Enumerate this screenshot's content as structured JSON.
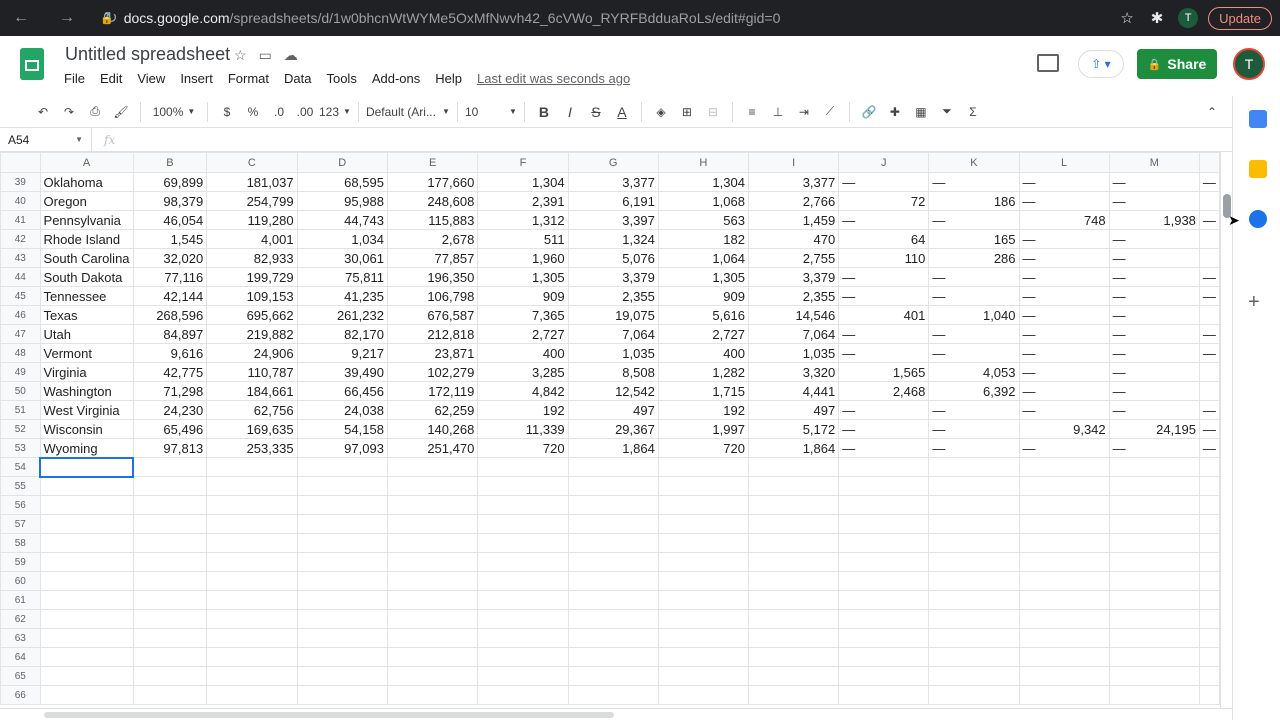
{
  "browser": {
    "url_host": "docs.google.com",
    "url_path": "/spreadsheets/d/1w0bhcnWtWYMe5OxMfNwvh42_6cVWo_RYRFBdduaRoLs/edit#gid=0",
    "profile_initial": "T",
    "update_label": "Update"
  },
  "doc": {
    "title": "Untitled spreadsheet",
    "menus": [
      "File",
      "Edit",
      "View",
      "Insert",
      "Format",
      "Data",
      "Tools",
      "Add-ons",
      "Help"
    ],
    "last_edit": "Last edit was seconds ago",
    "share_label": "Share",
    "avatar_initial": "T"
  },
  "toolbar": {
    "zoom": "100%",
    "currency": "$",
    "percent": "%",
    "dec_less": ".0",
    "dec_more": ".00",
    "more_formats": "123",
    "font": "Default (Ari...",
    "font_size": "10"
  },
  "formula_bar": {
    "name_box": "A54",
    "fx": "fx"
  },
  "grid": {
    "columns": [
      "A",
      "B",
      "C",
      "D",
      "E",
      "F",
      "G",
      "H",
      "I",
      "J",
      "K",
      "L",
      "M"
    ],
    "rows": [
      {
        "n": "39",
        "cells": [
          "Oklahoma",
          "69,899",
          "181,037",
          "68,595",
          "177,660",
          "1,304",
          "3,377",
          "1,304",
          "3,377",
          "—",
          "—",
          "—",
          "—",
          "—"
        ]
      },
      {
        "n": "40",
        "cells": [
          "Oregon",
          "98,379",
          "254,799",
          "95,988",
          "248,608",
          "2,391",
          "6,191",
          "1,068",
          "2,766",
          "72",
          "186",
          "—",
          "—",
          ""
        ]
      },
      {
        "n": "41",
        "cells": [
          "Pennsylvania",
          "46,054",
          "119,280",
          "44,743",
          "115,883",
          "1,312",
          "3,397",
          "563",
          "1,459",
          "—",
          "—",
          "748",
          "1,938",
          "—"
        ]
      },
      {
        "n": "42",
        "cells": [
          "Rhode Island",
          "1,545",
          "4,001",
          "1,034",
          "2,678",
          "511",
          "1,324",
          "182",
          "470",
          "64",
          "165",
          "—",
          "—",
          ""
        ]
      },
      {
        "n": "43",
        "cells": [
          "South Carolina",
          "32,020",
          "82,933",
          "30,061",
          "77,857",
          "1,960",
          "5,076",
          "1,064",
          "2,755",
          "110",
          "286",
          "—",
          "—",
          ""
        ]
      },
      {
        "n": "44",
        "cells": [
          "South Dakota",
          "77,116",
          "199,729",
          "75,811",
          "196,350",
          "1,305",
          "3,379",
          "1,305",
          "3,379",
          "—",
          "—",
          "—",
          "—",
          "—"
        ]
      },
      {
        "n": "45",
        "cells": [
          "Tennessee",
          "42,144",
          "109,153",
          "41,235",
          "106,798",
          "909",
          "2,355",
          "909",
          "2,355",
          "—",
          "—",
          "—",
          "—",
          "—"
        ]
      },
      {
        "n": "46",
        "cells": [
          "Texas",
          "268,596",
          "695,662",
          "261,232",
          "676,587",
          "7,365",
          "19,075",
          "5,616",
          "14,546",
          "401",
          "1,040",
          "—",
          "—",
          ""
        ]
      },
      {
        "n": "47",
        "cells": [
          "Utah",
          "84,897",
          "219,882",
          "82,170",
          "212,818",
          "2,727",
          "7,064",
          "2,727",
          "7,064",
          "—",
          "—",
          "—",
          "—",
          "—"
        ]
      },
      {
        "n": "48",
        "cells": [
          "Vermont",
          "9,616",
          "24,906",
          "9,217",
          "23,871",
          "400",
          "1,035",
          "400",
          "1,035",
          "—",
          "—",
          "—",
          "—",
          "—"
        ]
      },
      {
        "n": "49",
        "cells": [
          "Virginia",
          "42,775",
          "110,787",
          "39,490",
          "102,279",
          "3,285",
          "8,508",
          "1,282",
          "3,320",
          "1,565",
          "4,053",
          "—",
          "—",
          ""
        ]
      },
      {
        "n": "50",
        "cells": [
          "Washington",
          "71,298",
          "184,661",
          "66,456",
          "172,119",
          "4,842",
          "12,542",
          "1,715",
          "4,441",
          "2,468",
          "6,392",
          "—",
          "—",
          ""
        ]
      },
      {
        "n": "51",
        "cells": [
          "West Virginia",
          "24,230",
          "62,756",
          "24,038",
          "62,259",
          "192",
          "497",
          "192",
          "497",
          "—",
          "—",
          "—",
          "—",
          "—"
        ]
      },
      {
        "n": "52",
        "cells": [
          "Wisconsin",
          "65,496",
          "169,635",
          "54,158",
          "140,268",
          "11,339",
          "29,367",
          "1,997",
          "5,172",
          "—",
          "—",
          "9,342",
          "24,195",
          "—"
        ]
      },
      {
        "n": "53",
        "cells": [
          "Wyoming",
          "97,813",
          "253,335",
          "97,093",
          "251,470",
          "720",
          "1,864",
          "720",
          "1,864",
          "—",
          "—",
          "—",
          "—",
          "—"
        ]
      },
      {
        "n": "54",
        "cells": []
      },
      {
        "n": "55",
        "cells": []
      },
      {
        "n": "56",
        "cells": []
      },
      {
        "n": "57",
        "cells": []
      },
      {
        "n": "58",
        "cells": []
      },
      {
        "n": "59",
        "cells": []
      },
      {
        "n": "60",
        "cells": []
      },
      {
        "n": "61",
        "cells": []
      },
      {
        "n": "62",
        "cells": []
      },
      {
        "n": "63",
        "cells": []
      },
      {
        "n": "64",
        "cells": []
      },
      {
        "n": "65",
        "cells": []
      },
      {
        "n": "66",
        "cells": []
      }
    ],
    "selected_row": "54"
  }
}
